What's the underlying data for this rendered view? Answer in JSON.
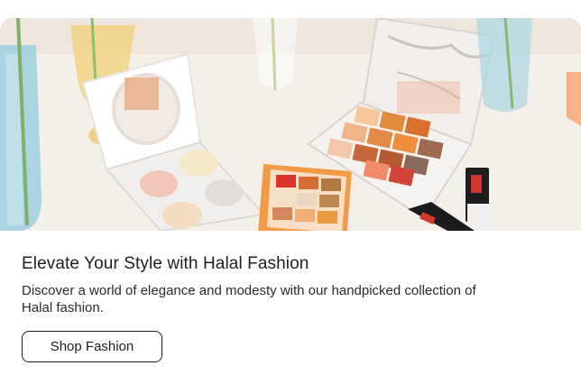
{
  "promo": {
    "title": "Elevate Your Style with Halal Fashion",
    "description": "Discover a world of elegance and modesty with our handpicked collection of Halal fashion.",
    "cta_label": "Shop Fashion"
  },
  "colors": {
    "background": "#ffffff",
    "text": "#1e1e1e",
    "button_border": "#1e1e1e"
  }
}
